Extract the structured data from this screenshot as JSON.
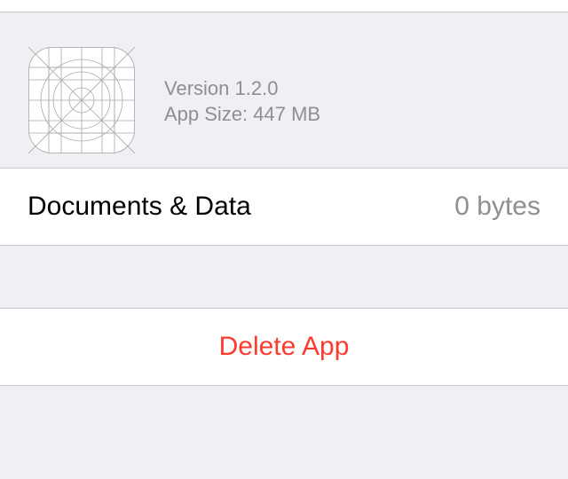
{
  "app": {
    "icon_name": "app-icon-placeholder-grid",
    "version": "Version 1.2.0",
    "size": "App Size: 447 MB"
  },
  "documents": {
    "label": "Documents & Data",
    "value": "0 bytes"
  },
  "actions": {
    "delete_label": "Delete App"
  },
  "colors": {
    "background": "#efeff4",
    "separator": "#c8c7cc",
    "secondary_text": "#8e8e93",
    "destructive": "#ff3b30"
  }
}
